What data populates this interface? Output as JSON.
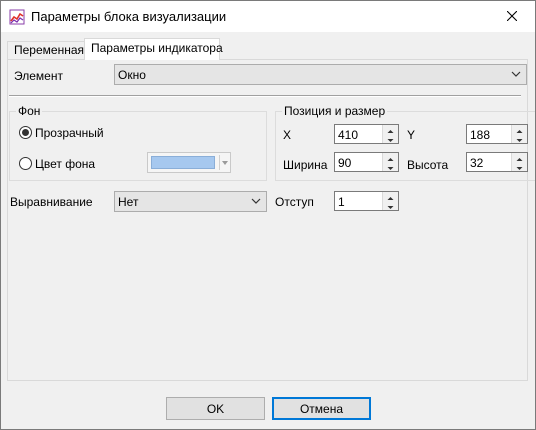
{
  "window": {
    "title": "Параметры блока визуализации",
    "icon": "app-chart-icon",
    "close_icon": "close-icon"
  },
  "tabs": [
    {
      "label": "Переменная",
      "active": false
    },
    {
      "label": "Параметры индикатора",
      "active": true
    }
  ],
  "element": {
    "label": "Элемент",
    "value": "Окно"
  },
  "background": {
    "group_label": "Фон",
    "transparent_label": "Прозрачный",
    "transparent_checked": true,
    "color_label": "Цвет фона",
    "color_checked": false,
    "color_value": "#a6c8ef"
  },
  "position": {
    "group_label": "Позиция и размер",
    "x_label": "X",
    "x_value": "410",
    "y_label": "Y",
    "y_value": "188",
    "width_label": "Ширина",
    "width_value": "90",
    "height_label": "Высота",
    "height_value": "32"
  },
  "alignment": {
    "label": "Выравнивание",
    "value": "Нет"
  },
  "indent": {
    "label": "Отступ",
    "value": "1"
  },
  "buttons": {
    "ok_label": "OK",
    "cancel_label": "Отмена"
  }
}
